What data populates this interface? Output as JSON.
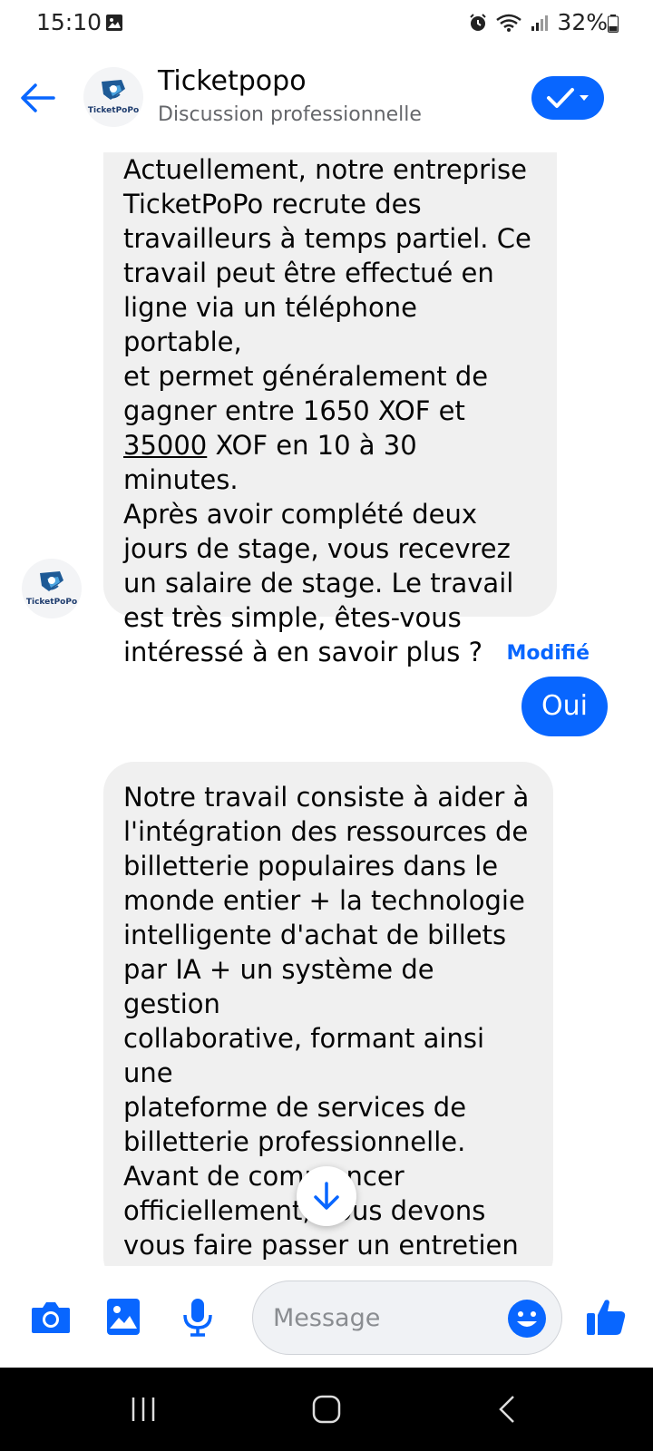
{
  "status_bar": {
    "time": "15:10",
    "battery": "32%",
    "icons": [
      "gallery-icon",
      "alarm-icon",
      "wifi-icon",
      "signal-icon",
      "battery-icon"
    ]
  },
  "header": {
    "name": "Ticketpopo",
    "subtitle": "Discussion professionnelle",
    "avatar_label": "TicketPoPo",
    "accent_color": "#0866ff"
  },
  "messages": {
    "incoming_1": "Actuellement, notre entreprise\nTicketPoPo recrute des\ntravailleurs à temps partiel. Ce\ntravail peut être effectué en\nligne via un téléphone portable,\net permet généralement de\ngagner entre 1650 XOF et",
    "incoming_1_underlined": "35000",
    "incoming_1_rest": " XOF en 10 à 30 minutes.\nAprès avoir complété deux\njours de stage, vous recevrez\nun salaire de stage. Le travail\nest très simple, êtes-vous\nintéressé à en savoir plus ?",
    "edited_label": "Modifié",
    "outgoing_1": "Oui",
    "incoming_2": "Notre travail consiste à aider à\nl'intégration des ressources de\nbilletterie populaires dans le\nmonde entier + la technologie\nintelligente d'achat de billets\npar IA + un système de gestion\ncollaborative, formant ainsi une\nplateforme de services de\nbilletterie professionnelle.\nAvant de commencer\nofficiellement, nous devons\nvous faire passer un entretien\nen ligne, veuillez répondre à un\nquestionnaire de base."
  },
  "composer": {
    "placeholder": "Message"
  }
}
